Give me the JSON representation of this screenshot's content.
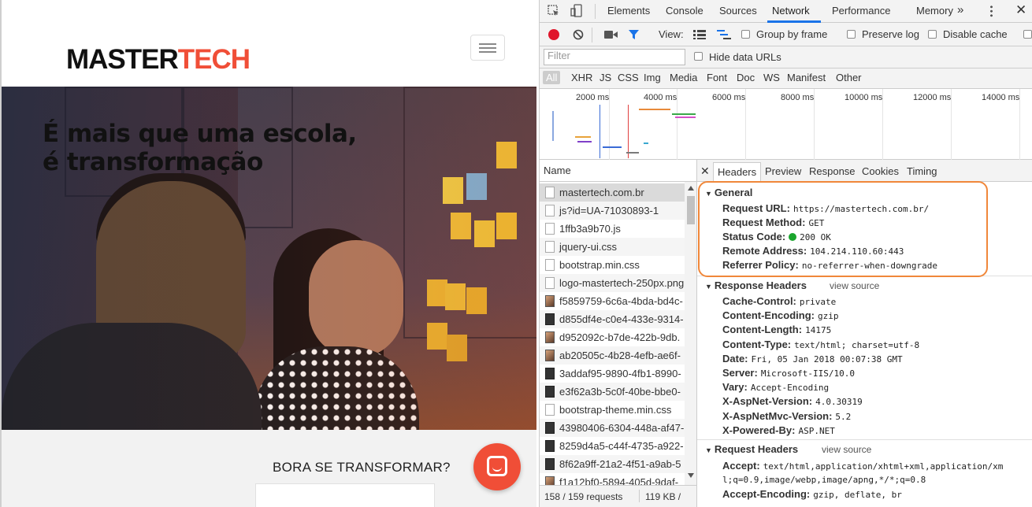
{
  "site": {
    "logo_part1": "MASTER",
    "logo_part2": "TECH",
    "hero_title_line1": "É mais que uma escola,",
    "hero_title_line2": "é transformação",
    "cta": "BORA SE TRANSFORMAR?",
    "brand_color": "#f04e37"
  },
  "devtools": {
    "tabs": [
      "Elements",
      "Console",
      "Sources",
      "Network",
      "Performance",
      "Memory"
    ],
    "selected_tab": "Network",
    "more_tabs_icon": "»",
    "toolbar": {
      "view_label": "View:",
      "group_by_frame": "Group by frame",
      "preserve_log": "Preserve log",
      "disable_cache": "Disable cache"
    },
    "filter_placeholder": "Filter",
    "hide_data_urls": "Hide data URLs",
    "filter_types": [
      "All",
      "XHR",
      "JS",
      "CSS",
      "Img",
      "Media",
      "Font",
      "Doc",
      "WS",
      "Manifest",
      "Other"
    ],
    "overview_ticks": [
      "2000 ms",
      "4000 ms",
      "6000 ms",
      "8000 ms",
      "10000 ms",
      "12000 ms",
      "14000 ms"
    ],
    "name_column": "Name",
    "requests": [
      {
        "name": "mastertech.com.br",
        "kind": "doc"
      },
      {
        "name": "js?id=UA-71030893-1",
        "kind": "doc"
      },
      {
        "name": "1ffb3a9b70.js",
        "kind": "doc"
      },
      {
        "name": "jquery-ui.css",
        "kind": "doc"
      },
      {
        "name": "bootstrap.min.css",
        "kind": "doc"
      },
      {
        "name": "logo-mastertech-250px.png",
        "kind": "doc"
      },
      {
        "name": "f5859759-6c6a-4bda-bd4c-",
        "kind": "img"
      },
      {
        "name": "d855df4e-c0e4-433e-9314-",
        "kind": "dark"
      },
      {
        "name": "d952092c-b7de-422b-9db.",
        "kind": "img"
      },
      {
        "name": "ab20505c-4b28-4efb-ae6f-",
        "kind": "img"
      },
      {
        "name": "3addaf95-9890-4fb1-8990-",
        "kind": "dark"
      },
      {
        "name": "e3f62a3b-5c0f-40be-bbe0-",
        "kind": "dark"
      },
      {
        "name": "bootstrap-theme.min.css",
        "kind": "doc"
      },
      {
        "name": "43980406-6304-448a-af47-",
        "kind": "dark"
      },
      {
        "name": "8259d4a5-c44f-4735-a922-",
        "kind": "dark"
      },
      {
        "name": "8f62a9ff-21a2-4f51-a9ab-5",
        "kind": "dark"
      },
      {
        "name": "f1a12bf0-5894-405d-9daf-",
        "kind": "img"
      }
    ],
    "summary_requests": "158 / 159 requests",
    "summary_size": "119 KB /",
    "detail_tabs": [
      "Headers",
      "Preview",
      "Response",
      "Cookies",
      "Timing"
    ],
    "selected_detail_tab": "Headers",
    "view_source": "view source",
    "general": {
      "title": "General",
      "rows": [
        {
          "k": "Request URL:",
          "v": "https://mastertech.com.br/"
        },
        {
          "k": "Request Method:",
          "v": "GET"
        },
        {
          "k": "Status Code:",
          "v": "200 OK"
        },
        {
          "k": "Remote Address:",
          "v": "104.214.110.60:443"
        },
        {
          "k": "Referrer Policy:",
          "v": "no-referrer-when-downgrade"
        }
      ]
    },
    "response_headers": {
      "title": "Response Headers",
      "rows": [
        {
          "k": "Cache-Control:",
          "v": "private"
        },
        {
          "k": "Content-Encoding:",
          "v": "gzip"
        },
        {
          "k": "Content-Length:",
          "v": "14175"
        },
        {
          "k": "Content-Type:",
          "v": "text/html; charset=utf-8"
        },
        {
          "k": "Date:",
          "v": "Fri, 05 Jan 2018 00:07:38 GMT"
        },
        {
          "k": "Server:",
          "v": "Microsoft-IIS/10.0"
        },
        {
          "k": "Vary:",
          "v": "Accept-Encoding"
        },
        {
          "k": "X-AspNet-Version:",
          "v": "4.0.30319"
        },
        {
          "k": "X-AspNetMvc-Version:",
          "v": "5.2"
        },
        {
          "k": "X-Powered-By:",
          "v": "ASP.NET"
        }
      ]
    },
    "request_headers": {
      "title": "Request Headers",
      "accept_key": "Accept:",
      "accept_value_1": "text/html,application/xhtml+xml,application/xm",
      "accept_value_2": "l;q=0.9,image/webp,image/apng,*/*;q=0.8",
      "encoding_key": "Accept-Encoding:",
      "encoding_value": "gzip, deflate, br"
    },
    "highlight_color": "#f0873a",
    "status_ok_color": "#1aa52d"
  }
}
